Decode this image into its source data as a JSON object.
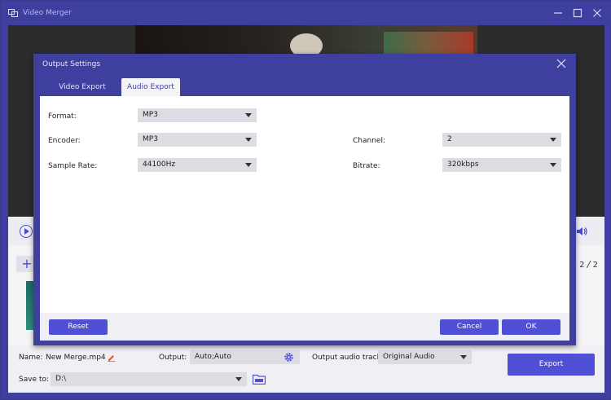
{
  "window": {
    "title": "Video Merger",
    "minimize_icon": "minimize-icon",
    "maximize_icon": "maximize-icon",
    "close_icon": "close-icon"
  },
  "player": {
    "page_current": "2",
    "page_total": "2"
  },
  "bottom": {
    "name_label": "Name:",
    "name_value": "New Merge.mp4",
    "output_label": "Output:",
    "output_value": "Auto;Auto",
    "audio_track_label": "Output audio track:",
    "audio_track_value": "Original Audio",
    "save_to_label": "Save to:",
    "save_to_value": "D:\\",
    "export_label": "Export"
  },
  "dialog": {
    "title": "Output Settings",
    "tabs": [
      {
        "label": "Video Export",
        "active": false
      },
      {
        "label": "Audio Export",
        "active": true
      }
    ],
    "fields": {
      "format": {
        "label": "Format:",
        "value": "MP3"
      },
      "encoder": {
        "label": "Encoder:",
        "value": "MP3"
      },
      "sample_rate": {
        "label": "Sample Rate:",
        "value": "44100Hz"
      },
      "channel": {
        "label": "Channel:",
        "value": "2"
      },
      "bitrate": {
        "label": "Bitrate:",
        "value": "320kbps"
      }
    },
    "buttons": {
      "reset": "Reset",
      "cancel": "Cancel",
      "ok": "OK"
    }
  },
  "colors": {
    "accent": "#5050d6",
    "frame": "#3f3fa0"
  }
}
